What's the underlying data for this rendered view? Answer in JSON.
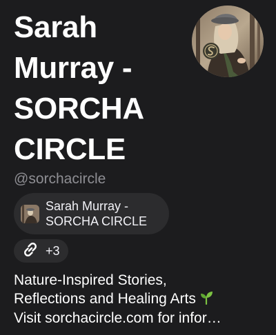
{
  "profile": {
    "display_name": "Sarah Murray - SORCHA CIRCLE",
    "handle": "@sorchacircle",
    "account_chip": {
      "name": "Sarah Murray - SORCHA CIRCLE"
    },
    "links": {
      "count_label": "+3"
    },
    "bio": {
      "line1": "Nature-Inspired Stories,",
      "line2": "Reflections and Healing Arts",
      "line3": "Visit sorchacircle.com for infor…"
    }
  },
  "icons": {
    "link": "link-icon",
    "sprout": "sprout-icon",
    "avatar_logo": "swirl-logo"
  },
  "colors": {
    "background": "#1c1c1e",
    "chip": "#2c2c2e",
    "handle": "#8e8e93",
    "sprout": "#7cc242"
  }
}
